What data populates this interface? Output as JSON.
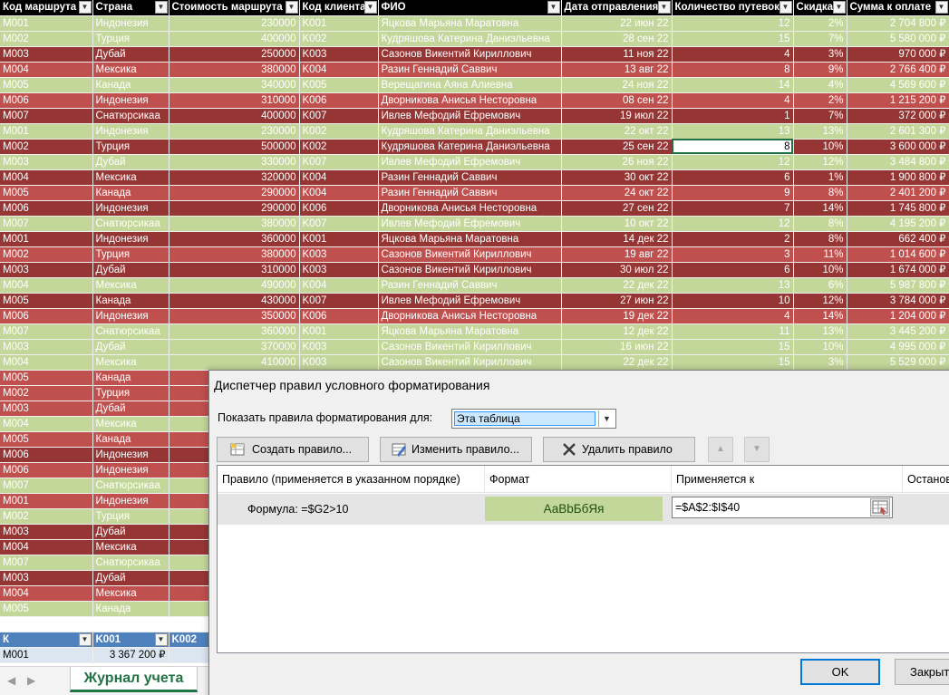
{
  "sheet": {
    "headers": [
      "Код маршрута",
      "Страна",
      "Стоимость маршрута",
      "Код клиента",
      "ФИО",
      "Дата отправления",
      "Количество путевок",
      "Скидка",
      "Сумма к оплате"
    ],
    "rows": [
      {
        "style": "green",
        "cells": [
          "M001",
          "Индонезия",
          "230000",
          "K001",
          "Яцкова  Марьяна Маратовна",
          "22 июн 22",
          "12",
          "2%",
          "2 704 800 ₽"
        ]
      },
      {
        "style": "green",
        "cells": [
          "M002",
          "Турция",
          "400000",
          "K002",
          "Кудряшова  Катерина Даниэльевна",
          "28 сен 22",
          "15",
          "7%",
          "5 580 000 ₽"
        ]
      },
      {
        "style": "dark",
        "cells": [
          "M003",
          "Дубай",
          "250000",
          "K003",
          "Сазонов  Викентий Кириллович",
          "11 ноя 22",
          "4",
          "3%",
          "970 000 ₽"
        ]
      },
      {
        "style": "red",
        "cells": [
          "M004",
          "Мексика",
          "380000",
          "K004",
          "Разин  Геннадий Саввич",
          "13 авг 22",
          "8",
          "9%",
          "2 766 400 ₽"
        ]
      },
      {
        "style": "green",
        "cells": [
          "M005",
          "Канада",
          "340000",
          "K005",
          "Верещагина  Аяна Алиевна",
          "24 ноя 22",
          "14",
          "4%",
          "4 569 600 ₽"
        ]
      },
      {
        "style": "red",
        "cells": [
          "M006",
          "Индонезия",
          "310000",
          "K006",
          "Дворникова  Анисья Несторовна",
          "08 сен 22",
          "4",
          "2%",
          "1 215 200 ₽"
        ]
      },
      {
        "style": "dark",
        "cells": [
          "M007",
          "Снатюрсикаа",
          "400000",
          "K007",
          "Ивлев  Мефодий Ефремович",
          "19 июл 22",
          "1",
          "7%",
          "372 000 ₽"
        ]
      },
      {
        "style": "green",
        "cells": [
          "M001",
          "Индонезия",
          "230000",
          "K002",
          "Кудряшова  Катерина Даниэльевна",
          "22 окт 22",
          "13",
          "13%",
          "2 601 300 ₽"
        ]
      },
      {
        "style": "dark",
        "cells": [
          "M002",
          "Турция",
          "500000",
          "K002",
          "Кудряшова  Катерина Даниэльевна",
          "25 сен 22",
          "8",
          "10%",
          "3 600 000 ₽"
        ]
      },
      {
        "style": "green",
        "cells": [
          "M003",
          "Дубай",
          "330000",
          "K007",
          "Ивлев  Мефодий Ефремович",
          "26 ноя 22",
          "12",
          "12%",
          "3 484 800 ₽"
        ]
      },
      {
        "style": "dark",
        "cells": [
          "M004",
          "Мексика",
          "320000",
          "K004",
          "Разин  Геннадий Саввич",
          "30 окт 22",
          "6",
          "1%",
          "1 900 800 ₽"
        ]
      },
      {
        "style": "red",
        "cells": [
          "M005",
          "Канада",
          "290000",
          "K004",
          "Разин  Геннадий Саввич",
          "24 окт 22",
          "9",
          "8%",
          "2 401 200 ₽"
        ]
      },
      {
        "style": "dark",
        "cells": [
          "M006",
          "Индонезия",
          "290000",
          "K006",
          "Дворникова  Анисья Несторовна",
          "27 сен 22",
          "7",
          "14%",
          "1 745 800 ₽"
        ]
      },
      {
        "style": "green",
        "cells": [
          "M007",
          "Снатюрсикаа",
          "380000",
          "K007",
          "Ивлев  Мефодий Ефремович",
          "10 окт 22",
          "12",
          "8%",
          "4 195 200 ₽"
        ]
      },
      {
        "style": "dark",
        "cells": [
          "M001",
          "Индонезия",
          "360000",
          "K001",
          "Яцкова  Марьяна Маратовна",
          "14 дек 22",
          "2",
          "8%",
          "662 400 ₽"
        ]
      },
      {
        "style": "red",
        "cells": [
          "M002",
          "Турция",
          "380000",
          "K003",
          "Сазонов  Викентий Кириллович",
          "19 авг 22",
          "3",
          "11%",
          "1 014 600 ₽"
        ]
      },
      {
        "style": "dark",
        "cells": [
          "M003",
          "Дубай",
          "310000",
          "K003",
          "Сазонов  Викентий Кириллович",
          "30 июл 22",
          "6",
          "10%",
          "1 674 000 ₽"
        ]
      },
      {
        "style": "green",
        "cells": [
          "M004",
          "Мексика",
          "490000",
          "K004",
          "Разин  Геннадий Саввич",
          "22 дек 22",
          "13",
          "6%",
          "5 987 800 ₽"
        ]
      },
      {
        "style": "dark",
        "cells": [
          "M005",
          "Канада",
          "430000",
          "K007",
          "Ивлев  Мефодий Ефремович",
          "27 июн 22",
          "10",
          "12%",
          "3 784 000 ₽"
        ]
      },
      {
        "style": "red",
        "cells": [
          "M006",
          "Индонезия",
          "350000",
          "K006",
          "Дворникова  Анисья Несторовна",
          "19 дек 22",
          "4",
          "14%",
          "1 204 000 ₽"
        ]
      },
      {
        "style": "green",
        "cells": [
          "M007",
          "Снатюрсикаа",
          "360000",
          "K001",
          "Яцкова  Марьяна Маратовна",
          "12 дек 22",
          "11",
          "13%",
          "3 445 200 ₽"
        ]
      },
      {
        "style": "green",
        "cells": [
          "M003",
          "Дубай",
          "370000",
          "K003",
          "Сазонов  Викентий Кириллович",
          "16 июн 22",
          "15",
          "10%",
          "4 995 000 ₽"
        ]
      },
      {
        "style": "green",
        "cells": [
          "M004",
          "Мексика",
          "410000",
          "K003",
          "Сазонов  Викентий Кириллович",
          "22 дек 22",
          "15",
          "3%",
          "5 529 000 ₽"
        ]
      },
      {
        "style": "red",
        "cells": [
          "M005",
          "Канада",
          "",
          "",
          "",
          "",
          "",
          "",
          ""
        ]
      },
      {
        "style": "red",
        "cells": [
          "M002",
          "Турция",
          "",
          "",
          "",
          "",
          "",
          "",
          ""
        ]
      },
      {
        "style": "red",
        "cells": [
          "M003",
          "Дубай",
          "",
          "",
          "",
          "",
          "",
          "",
          ""
        ]
      },
      {
        "style": "green",
        "cells": [
          "M004",
          "Мексика",
          "",
          "",
          "",
          "",
          "",
          "",
          ""
        ]
      },
      {
        "style": "red",
        "cells": [
          "M005",
          "Канада",
          "",
          "",
          "",
          "",
          "",
          "",
          ""
        ]
      },
      {
        "style": "dark",
        "cells": [
          "M006",
          "Индонезия",
          "",
          "",
          "",
          "",
          "",
          "",
          ""
        ]
      },
      {
        "style": "red",
        "cells": [
          "M006",
          "Индонезия",
          "",
          "",
          "",
          "",
          "",
          "",
          ""
        ]
      },
      {
        "style": "green",
        "cells": [
          "M007",
          "Снатюрсикаа",
          "",
          "",
          "",
          "",
          "",
          "",
          ""
        ]
      },
      {
        "style": "red",
        "cells": [
          "M001",
          "Индонезия",
          "",
          "",
          "",
          "",
          "",
          "",
          ""
        ]
      },
      {
        "style": "green",
        "cells": [
          "M002",
          "Турция",
          "",
          "",
          "",
          "",
          "",
          "",
          ""
        ]
      },
      {
        "style": "dark",
        "cells": [
          "M003",
          "Дубай",
          "",
          "",
          "",
          "",
          "",
          "",
          ""
        ]
      },
      {
        "style": "dark",
        "cells": [
          "M004",
          "Мексика",
          "",
          "",
          "",
          "",
          "",
          "",
          ""
        ]
      },
      {
        "style": "green",
        "cells": [
          "M007",
          "Снатюрсикаа",
          "",
          "",
          "",
          "",
          "",
          "",
          ""
        ]
      },
      {
        "style": "dark",
        "cells": [
          "M003",
          "Дубай",
          "",
          "",
          "",
          "",
          "",
          "",
          ""
        ]
      },
      {
        "style": "red",
        "cells": [
          "M004",
          "Мексика",
          "",
          "",
          "",
          "",
          "",
          "",
          ""
        ]
      },
      {
        "style": "green",
        "cells": [
          "M005",
          "Канада",
          "",
          "",
          "",
          "",
          "",
          "",
          ""
        ]
      }
    ],
    "selected_cell": {
      "row": 8,
      "col": 6
    },
    "pivot": {
      "headers": [
        "К",
        "K001",
        "K002"
      ],
      "row": [
        "M001",
        "3 367 200 ₽",
        ""
      ]
    },
    "colors": {
      "green": "#c4d79b",
      "red": "#c0504d",
      "dark": "#963634",
      "header": "#000000",
      "pivot_header": "#4f81bd"
    }
  },
  "sheetbar": {
    "prev_icon": "triangle-left-icon",
    "next_icon": "triangle-right-icon",
    "active_tab": "Журнал учета"
  },
  "dialog": {
    "title": "Диспетчер правил условного форматирования",
    "show_label": "Показать правила форматирования для:",
    "scope_value": "Эта таблица",
    "buttons": {
      "create": "Создать правило...",
      "edit": "Изменить правило...",
      "delete": "Удалить правило"
    },
    "columns": {
      "rule": "Правило (применяется в указанном порядке)",
      "format": "Формат",
      "applies": "Применяется к",
      "stop": "Останов"
    },
    "rule": {
      "formula": "Формула: =$G2>10",
      "format_preview": "АаВbБбЯя",
      "format_color": "#c4d79b",
      "applies_to": "=$A$2:$I$40"
    },
    "ok_label": "OK",
    "close_label": "Закрыть"
  }
}
